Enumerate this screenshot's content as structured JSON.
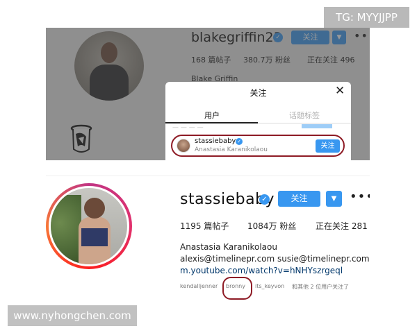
{
  "watermarks": {
    "top_right": "TG: MYYJJPP",
    "bottom_left": "www.nyhongchen.com"
  },
  "top_profile": {
    "username": "blakegriffin23",
    "follow_label": "关注",
    "stats": {
      "posts": "168 篇帖子",
      "followers": "380.7万 粉丝",
      "following": "正在关注 496"
    },
    "full_name": "Blake Griffin",
    "icons": [
      "verified-badge-icon",
      "chevron-down-icon",
      "more-options-icon",
      "team-logo-icon"
    ]
  },
  "following_modal": {
    "title": "关注",
    "tabs": [
      {
        "label": "用户",
        "active": true
      },
      {
        "label": "话题标签",
        "active": false
      }
    ],
    "highlighted_user": {
      "username": "stassiebaby",
      "full_name": "Anastasia Karanikolaou",
      "follow_label": "关注"
    }
  },
  "bottom_profile": {
    "username": "stassiebaby",
    "follow_label": "关注",
    "stats": {
      "posts": "1195 篇帖子",
      "followers": "1084万 粉丝",
      "following": "正在关注 281"
    },
    "full_name": "Anastasia Karanikolaou",
    "emails": "alexis@timelinepr.com susie@timelinepr.com",
    "link": "m.youtube.com/watch?v=hNHYszrgeql",
    "mutual": {
      "user1": "kendalljenner",
      "user2": "bronny",
      "user3": "its_keyvon",
      "suffix": "和其他 2 位用户关注了"
    },
    "highlighted_mutual": "bronny"
  },
  "colors": {
    "accent_blue": "#3897f0",
    "highlight_red": "#8e1b25",
    "link_blue": "#00376b"
  }
}
